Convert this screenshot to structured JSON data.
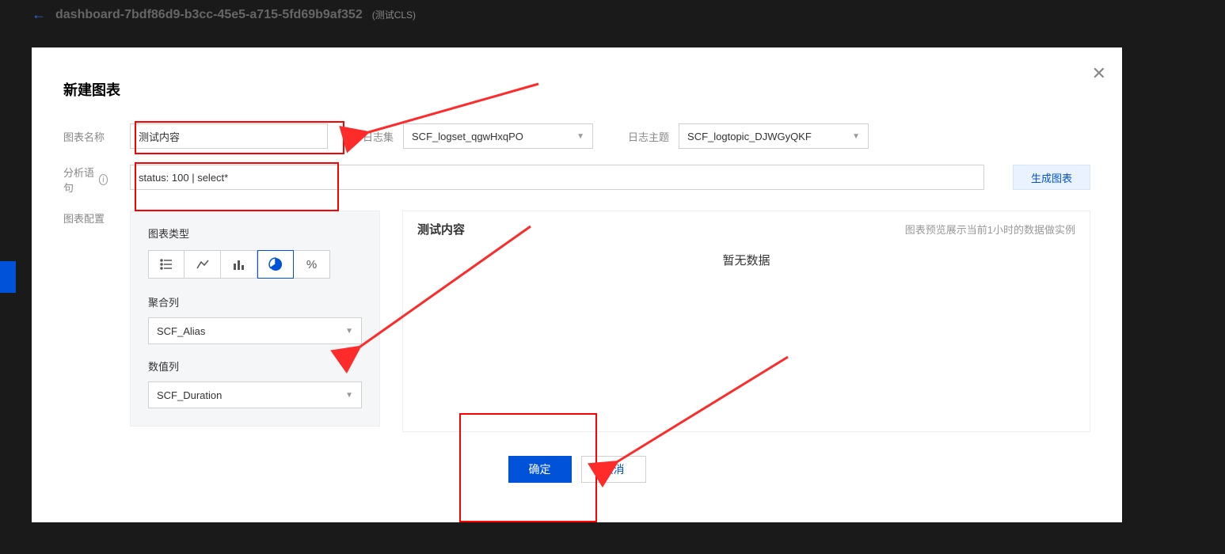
{
  "header": {
    "title": "dashboard-7bdf86d9-b3cc-45e5-a715-5fd69b9af352",
    "subtitle": "(测试CLS)"
  },
  "modal": {
    "title": "新建图表",
    "labels": {
      "chart_name": "图表名称",
      "log_set": "日志集",
      "log_topic": "日志主题",
      "query": "分析语句",
      "chart_config": "图表配置"
    },
    "values": {
      "chart_name": "测试内容",
      "log_set": "SCF_logset_qgwHxqPO",
      "log_topic": "SCF_logtopic_DJWGyQKF",
      "query": "status: 100 | select*"
    },
    "gen_button": "生成图表",
    "config": {
      "chart_type_label": "图表类型",
      "agg_col_label": "聚合列",
      "agg_col_value": "SCF_Alias",
      "val_col_label": "数值列",
      "val_col_value": "SCF_Duration",
      "chart_types": {
        "list": "list",
        "line": "line",
        "bar": "bar",
        "pie": "pie",
        "percent": "%"
      }
    },
    "preview": {
      "title": "测试内容",
      "note": "图表预览展示当前1小时的数据做实例",
      "empty": "暂无数据"
    },
    "actions": {
      "ok": "确定",
      "cancel": "取消"
    }
  }
}
